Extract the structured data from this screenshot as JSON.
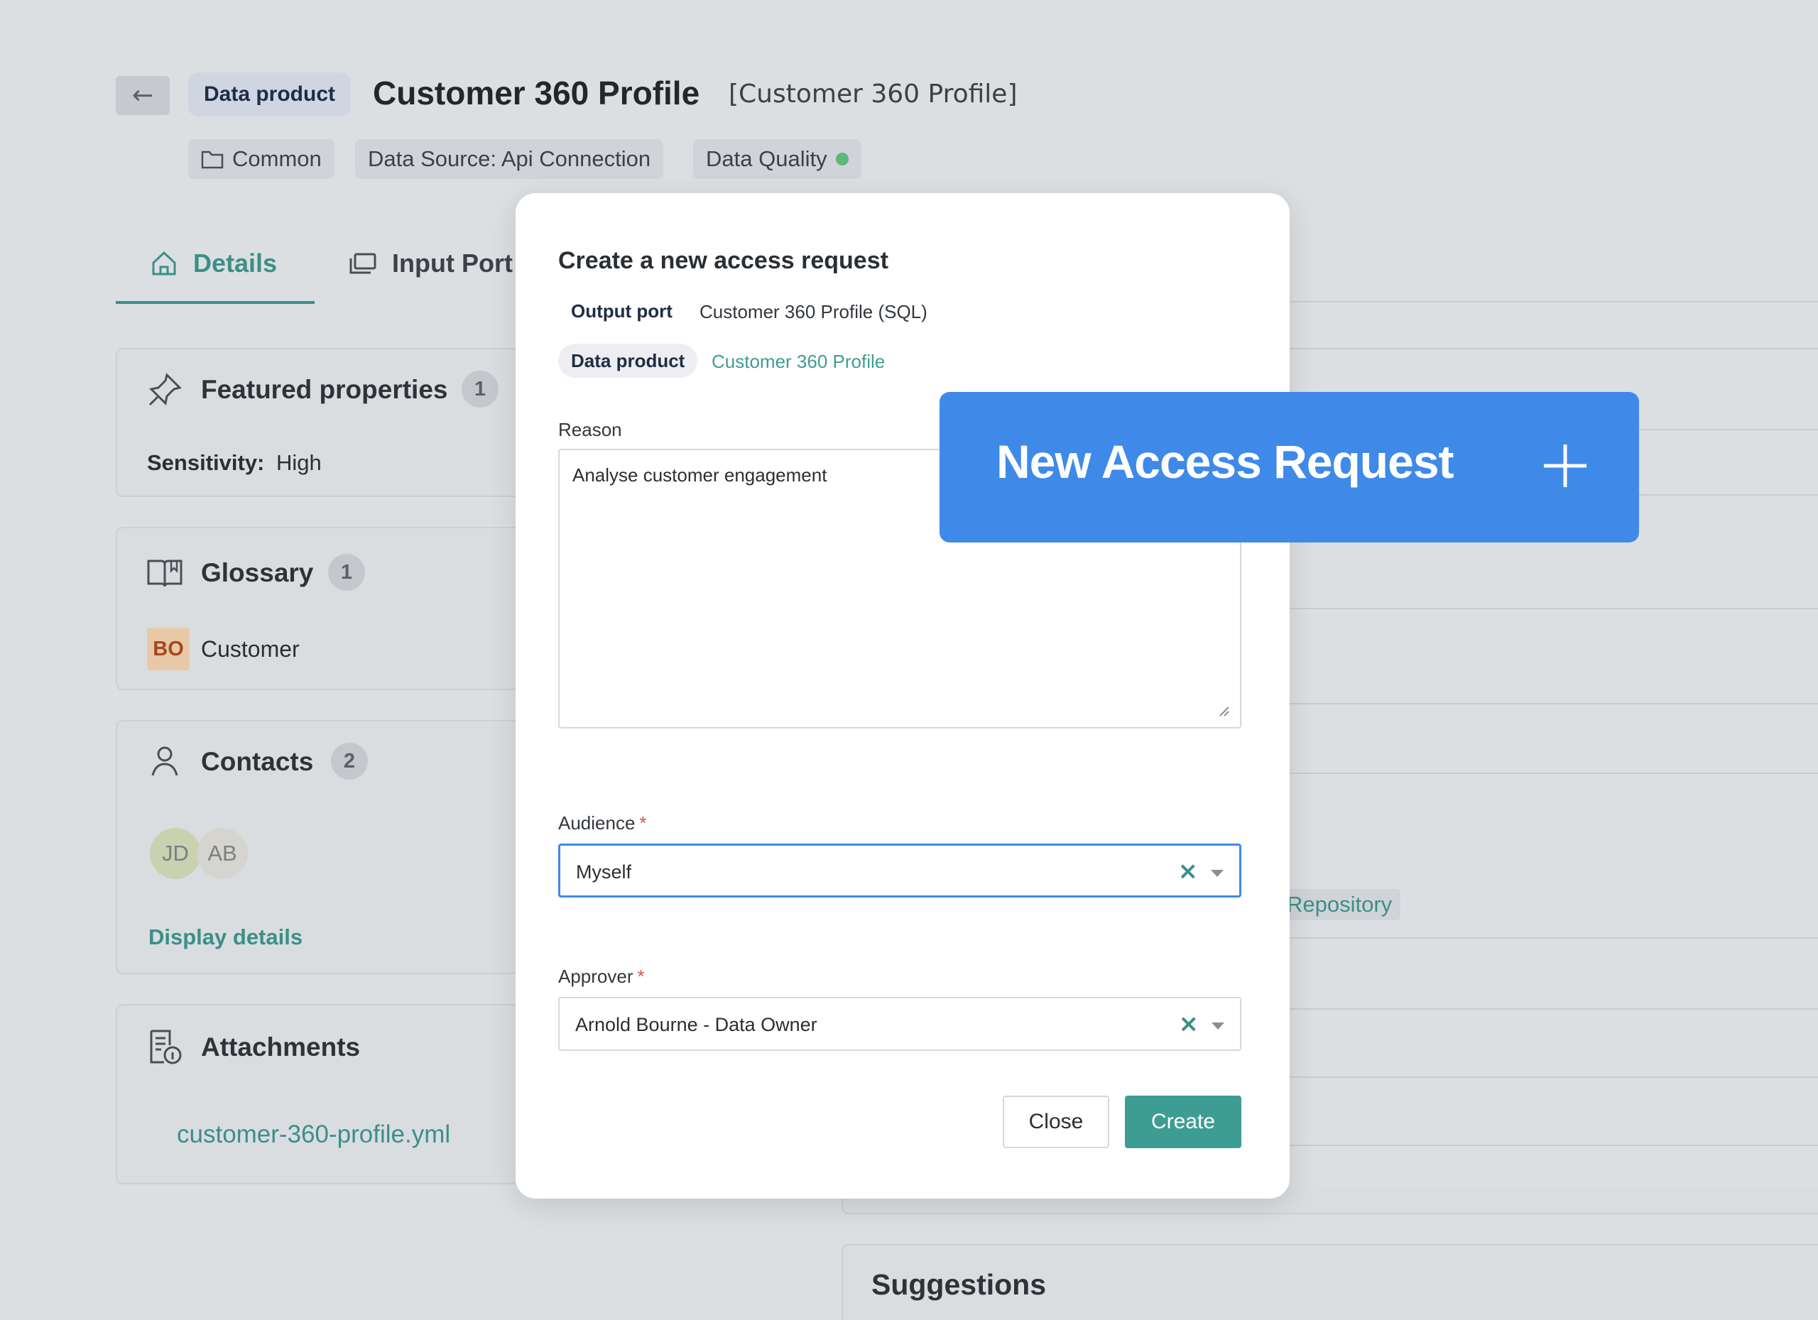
{
  "header": {
    "back_icon": "back-arrow-icon",
    "type_chip": "Data product",
    "title": "Customer 360 Profile",
    "technical_name": "[Customer 360 Profile]",
    "meta": {
      "domain": "Common",
      "source": "Data Source: Api Connection",
      "quality": "Data Quality",
      "quality_status_color": "#5cb877"
    }
  },
  "tabs": [
    {
      "label": "Details",
      "icon": "home-icon",
      "active": true
    },
    {
      "label": "Input Port",
      "icon": "stack-icon",
      "active": false
    }
  ],
  "cards": {
    "featured": {
      "title": "Featured properties",
      "count": "1",
      "sensitivity_label": "Sensitivity:",
      "sensitivity_value": "High"
    },
    "glossary": {
      "title": "Glossary",
      "count": "1",
      "badge": "BO",
      "term": "Customer"
    },
    "contacts": {
      "title": "Contacts",
      "count": "2",
      "avatars": [
        "JD",
        "AB"
      ],
      "link": "Display details"
    },
    "attachments": {
      "title": "Attachments",
      "file": "customer-360-profile.yml"
    }
  },
  "right": {
    "repository_chip": "Repository",
    "suggestions_title": "Suggestions"
  },
  "modal": {
    "title": "Create a new access request",
    "output_port_tag": "Output port",
    "output_port_value": "Customer 360 Profile (SQL)",
    "data_product_tag": "Data product",
    "data_product_value": "Customer 360 Profile",
    "reason_label": "Reason",
    "reason_value": "Analyse customer engagement",
    "audience_label": "Audience",
    "audience_value": "Myself",
    "approver_label": "Approver",
    "approver_value": "Arnold Bourne - Data Owner",
    "required_mark": "*",
    "clear_glyph": "×",
    "close_label": "Close",
    "create_label": "Create"
  },
  "callout": {
    "text": "New Access Request",
    "icon": "plus-icon"
  },
  "colors": {
    "accent": "#3e9d93",
    "callout": "#3f8ae8",
    "link": "#3b8f88"
  }
}
